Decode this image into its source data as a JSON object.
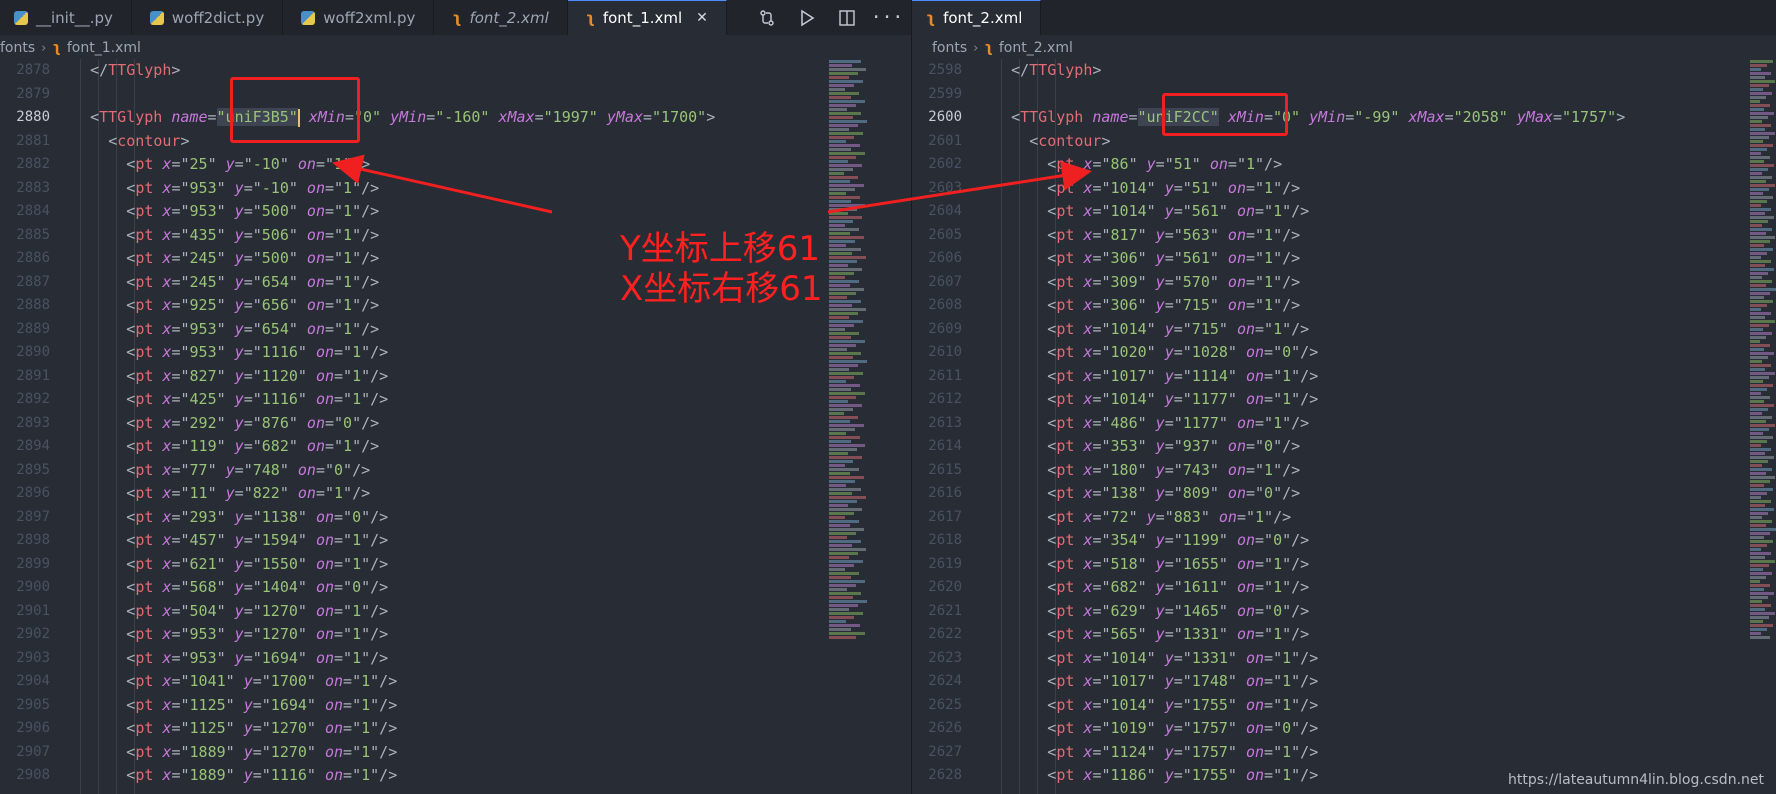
{
  "left_editor": {
    "tabs": [
      {
        "label": "__init__.py",
        "icon": "python-file-icon",
        "active": false,
        "italic": false
      },
      {
        "label": "woff2dict.py",
        "icon": "python-file-icon",
        "active": false,
        "italic": false
      },
      {
        "label": "woff2xml.py",
        "icon": "python-file-icon",
        "active": false,
        "italic": false
      },
      {
        "label": "font_2.xml",
        "icon": "xml-file-icon",
        "active": false,
        "italic": true
      },
      {
        "label": "font_1.xml",
        "icon": "xml-file-icon",
        "active": true,
        "italic": false
      }
    ],
    "breadcrumb": [
      "fonts",
      "font_1.xml"
    ],
    "current_line": 2880,
    "lines": [
      {
        "n": 2878,
        "indent": 1,
        "tokens": [
          [
            "punc",
            "</"
          ],
          [
            "tag",
            "TTGlyph"
          ],
          [
            "punc",
            ">"
          ]
        ]
      },
      {
        "n": 2879,
        "indent": 0,
        "tokens": []
      },
      {
        "n": 2880,
        "indent": 1,
        "tokens": [
          [
            "punc",
            "<"
          ],
          [
            "tag",
            "TTGlyph"
          ],
          [
            "punc",
            " "
          ],
          [
            "attr",
            "name"
          ],
          [
            "punc",
            "="
          ],
          [
            "str",
            "\"uniF3B5\""
          ],
          [
            "punc",
            " "
          ],
          [
            "attr",
            "xMin"
          ],
          [
            "punc",
            "="
          ],
          [
            "str",
            "\"0\""
          ],
          [
            "punc",
            " "
          ],
          [
            "attr",
            "yMin"
          ],
          [
            "punc",
            "="
          ],
          [
            "str",
            "\"-160\""
          ],
          [
            "punc",
            " "
          ],
          [
            "attr",
            "xMax"
          ],
          [
            "punc",
            "="
          ],
          [
            "str",
            "\"1997\""
          ],
          [
            "punc",
            " "
          ],
          [
            "attr",
            "yMax"
          ],
          [
            "punc",
            "="
          ],
          [
            "str",
            "\"1700\""
          ],
          [
            "punc",
            ">"
          ]
        ]
      },
      {
        "n": 2881,
        "indent": 2,
        "tokens": [
          [
            "punc",
            "<"
          ],
          [
            "tag",
            "contour"
          ],
          [
            "punc",
            ">"
          ]
        ]
      },
      {
        "n": 2882,
        "indent": 3,
        "pt": [
          "25",
          "-10",
          "1"
        ]
      },
      {
        "n": 2883,
        "indent": 3,
        "pt": [
          "953",
          "-10",
          "1"
        ]
      },
      {
        "n": 2884,
        "indent": 3,
        "pt": [
          "953",
          "500",
          "1"
        ]
      },
      {
        "n": 2885,
        "indent": 3,
        "pt": [
          "435",
          "506",
          "1"
        ]
      },
      {
        "n": 2886,
        "indent": 3,
        "pt": [
          "245",
          "500",
          "1"
        ]
      },
      {
        "n": 2887,
        "indent": 3,
        "pt": [
          "245",
          "654",
          "1"
        ]
      },
      {
        "n": 2888,
        "indent": 3,
        "pt": [
          "925",
          "656",
          "1"
        ]
      },
      {
        "n": 2889,
        "indent": 3,
        "pt": [
          "953",
          "654",
          "1"
        ]
      },
      {
        "n": 2890,
        "indent": 3,
        "pt": [
          "953",
          "1116",
          "1"
        ]
      },
      {
        "n": 2891,
        "indent": 3,
        "pt": [
          "827",
          "1120",
          "1"
        ]
      },
      {
        "n": 2892,
        "indent": 3,
        "pt": [
          "425",
          "1116",
          "1"
        ]
      },
      {
        "n": 2893,
        "indent": 3,
        "pt": [
          "292",
          "876",
          "0"
        ]
      },
      {
        "n": 2894,
        "indent": 3,
        "pt": [
          "119",
          "682",
          "1"
        ]
      },
      {
        "n": 2895,
        "indent": 3,
        "pt": [
          "77",
          "748",
          "0"
        ]
      },
      {
        "n": 2896,
        "indent": 3,
        "pt": [
          "11",
          "822",
          "1"
        ]
      },
      {
        "n": 2897,
        "indent": 3,
        "pt": [
          "293",
          "1138",
          "0"
        ]
      },
      {
        "n": 2898,
        "indent": 3,
        "pt": [
          "457",
          "1594",
          "1"
        ]
      },
      {
        "n": 2899,
        "indent": 3,
        "pt": [
          "621",
          "1550",
          "1"
        ]
      },
      {
        "n": 2900,
        "indent": 3,
        "pt": [
          "568",
          "1404",
          "0"
        ]
      },
      {
        "n": 2901,
        "indent": 3,
        "pt": [
          "504",
          "1270",
          "1"
        ]
      },
      {
        "n": 2902,
        "indent": 3,
        "pt": [
          "953",
          "1270",
          "1"
        ]
      },
      {
        "n": 2903,
        "indent": 3,
        "pt": [
          "953",
          "1694",
          "1"
        ]
      },
      {
        "n": 2904,
        "indent": 3,
        "pt": [
          "1041",
          "1700",
          "1"
        ]
      },
      {
        "n": 2905,
        "indent": 3,
        "pt": [
          "1125",
          "1694",
          "1"
        ]
      },
      {
        "n": 2906,
        "indent": 3,
        "pt": [
          "1125",
          "1270",
          "1"
        ]
      },
      {
        "n": 2907,
        "indent": 3,
        "pt": [
          "1889",
          "1270",
          "1"
        ]
      },
      {
        "n": 2908,
        "indent": 3,
        "pt": [
          "1889",
          "1116",
          "1"
        ]
      }
    ]
  },
  "right_editor": {
    "tabs": [
      {
        "label": "font_2.xml",
        "icon": "xml-file-icon",
        "active": true,
        "italic": false
      }
    ],
    "breadcrumb": [
      "fonts",
      "font_2.xml"
    ],
    "current_line": 2600,
    "lines": [
      {
        "n": 2598,
        "indent": 1,
        "tokens": [
          [
            "punc",
            "</"
          ],
          [
            "tag",
            "TTGlyph"
          ],
          [
            "punc",
            ">"
          ]
        ]
      },
      {
        "n": 2599,
        "indent": 0,
        "tokens": []
      },
      {
        "n": 2600,
        "indent": 1,
        "tokens": [
          [
            "punc",
            "<"
          ],
          [
            "tag",
            "TTGlyph"
          ],
          [
            "punc",
            " "
          ],
          [
            "attr",
            "name"
          ],
          [
            "punc",
            "="
          ],
          [
            "str",
            "\"uniF2CC\""
          ],
          [
            "punc",
            " "
          ],
          [
            "attr",
            "xMin"
          ],
          [
            "punc",
            "="
          ],
          [
            "str",
            "\"0\""
          ],
          [
            "punc",
            " "
          ],
          [
            "attr",
            "yMin"
          ],
          [
            "punc",
            "="
          ],
          [
            "str",
            "\"-99\""
          ],
          [
            "punc",
            " "
          ],
          [
            "attr",
            "xMax"
          ],
          [
            "punc",
            "="
          ],
          [
            "str",
            "\"2058\""
          ],
          [
            "punc",
            " "
          ],
          [
            "attr",
            "yMax"
          ],
          [
            "punc",
            "="
          ],
          [
            "str",
            "\"1757\""
          ],
          [
            "punc",
            ">"
          ]
        ]
      },
      {
        "n": 2601,
        "indent": 2,
        "tokens": [
          [
            "punc",
            "<"
          ],
          [
            "tag",
            "contour"
          ],
          [
            "punc",
            ">"
          ]
        ]
      },
      {
        "n": 2602,
        "indent": 3,
        "pt": [
          "86",
          "51",
          "1"
        ]
      },
      {
        "n": 2603,
        "indent": 3,
        "pt": [
          "1014",
          "51",
          "1"
        ]
      },
      {
        "n": 2604,
        "indent": 3,
        "pt": [
          "1014",
          "561",
          "1"
        ]
      },
      {
        "n": 2605,
        "indent": 3,
        "pt": [
          "817",
          "563",
          "1"
        ]
      },
      {
        "n": 2606,
        "indent": 3,
        "pt": [
          "306",
          "561",
          "1"
        ]
      },
      {
        "n": 2607,
        "indent": 3,
        "pt": [
          "309",
          "570",
          "1"
        ]
      },
      {
        "n": 2608,
        "indent": 3,
        "pt": [
          "306",
          "715",
          "1"
        ]
      },
      {
        "n": 2609,
        "indent": 3,
        "pt": [
          "1014",
          "715",
          "1"
        ]
      },
      {
        "n": 2610,
        "indent": 3,
        "pt": [
          "1020",
          "1028",
          "0"
        ]
      },
      {
        "n": 2611,
        "indent": 3,
        "pt": [
          "1017",
          "1114",
          "1"
        ]
      },
      {
        "n": 2612,
        "indent": 3,
        "pt": [
          "1014",
          "1177",
          "1"
        ]
      },
      {
        "n": 2613,
        "indent": 3,
        "pt": [
          "486",
          "1177",
          "1"
        ]
      },
      {
        "n": 2614,
        "indent": 3,
        "pt": [
          "353",
          "937",
          "0"
        ]
      },
      {
        "n": 2615,
        "indent": 3,
        "pt": [
          "180",
          "743",
          "1"
        ]
      },
      {
        "n": 2616,
        "indent": 3,
        "pt": [
          "138",
          "809",
          "0"
        ]
      },
      {
        "n": 2617,
        "indent": 3,
        "pt": [
          "72",
          "883",
          "1"
        ]
      },
      {
        "n": 2618,
        "indent": 3,
        "pt": [
          "354",
          "1199",
          "0"
        ]
      },
      {
        "n": 2619,
        "indent": 3,
        "pt": [
          "518",
          "1655",
          "1"
        ]
      },
      {
        "n": 2620,
        "indent": 3,
        "pt": [
          "682",
          "1611",
          "1"
        ]
      },
      {
        "n": 2621,
        "indent": 3,
        "pt": [
          "629",
          "1465",
          "0"
        ]
      },
      {
        "n": 2622,
        "indent": 3,
        "pt": [
          "565",
          "1331",
          "1"
        ]
      },
      {
        "n": 2623,
        "indent": 3,
        "pt": [
          "1014",
          "1331",
          "1"
        ]
      },
      {
        "n": 2624,
        "indent": 3,
        "pt": [
          "1017",
          "1748",
          "1"
        ]
      },
      {
        "n": 2625,
        "indent": 3,
        "pt": [
          "1014",
          "1755",
          "1"
        ]
      },
      {
        "n": 2626,
        "indent": 3,
        "pt": [
          "1019",
          "1757",
          "0"
        ]
      },
      {
        "n": 2627,
        "indent": 3,
        "pt": [
          "1124",
          "1757",
          "1"
        ]
      },
      {
        "n": 2628,
        "indent": 3,
        "pt": [
          "1186",
          "1755",
          "1"
        ]
      }
    ]
  },
  "annotation": {
    "line1": "Y坐标上移61",
    "line2": "X坐标右移61",
    "color": "#ff2020"
  },
  "watermark": "https://lateautumn4lin.blog.csdn.net",
  "colors": {
    "background": "#282c34",
    "tag": "#e06c75",
    "attr": "#c678dd",
    "string": "#98c379",
    "punctuation": "#abb2bf",
    "line_number": "#495162"
  }
}
